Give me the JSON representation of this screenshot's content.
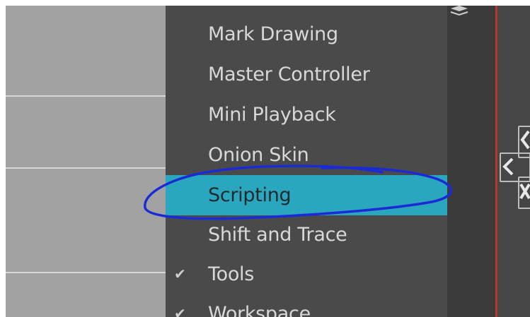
{
  "menu": {
    "items": [
      {
        "label": "Mark Drawing",
        "checked": false,
        "highlighted": false
      },
      {
        "label": "Master Controller",
        "checked": false,
        "highlighted": false
      },
      {
        "label": "Mini Playback",
        "checked": false,
        "highlighted": false
      },
      {
        "label": "Onion Skin",
        "checked": false,
        "highlighted": false
      },
      {
        "label": "Scripting",
        "checked": false,
        "highlighted": true
      },
      {
        "label": "Shift and Trace",
        "checked": false,
        "highlighted": false
      },
      {
        "label": "Tools",
        "checked": true,
        "highlighted": false
      },
      {
        "label": "Workspace",
        "checked": true,
        "highlighted": false
      }
    ],
    "check_glyph": "✔"
  },
  "right_controls": {
    "prev_glyph": "<",
    "close_glyph": "×"
  },
  "colors": {
    "menu_background": "#4a4a4a",
    "highlight": "#2aa6be",
    "annotation_ink": "#1a2bd6",
    "accent_line": "#b6382c"
  }
}
